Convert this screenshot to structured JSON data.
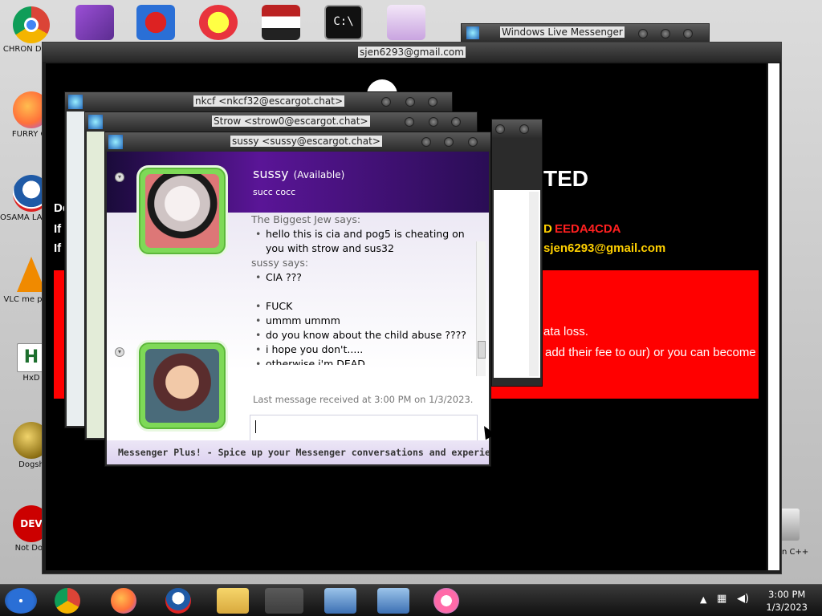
{
  "desktop": {
    "icons": [
      {
        "label": "CHRON DISEA",
        "icon": "chrome-icon",
        "color": "#db4437"
      },
      {
        "label": "FURRY CL",
        "icon": "firefox-icon",
        "color": "#ff7139"
      },
      {
        "label": "OSAMA LADEN B",
        "icon": "obama-logo-icon",
        "color": "#1f5aa6"
      },
      {
        "label": "VLC me playe",
        "icon": "vlc-cone-icon",
        "color": "#f08a00"
      },
      {
        "label": "HxD",
        "icon": "hxd-icon",
        "color": "#1d6f2e"
      },
      {
        "label": "Dogsh",
        "icon": "dogsh-icon",
        "color": "#b8860b"
      },
      {
        "label": "Not Dog",
        "icon": "dev-cpp-icon",
        "color": "#cc0000"
      }
    ],
    "top_icons": [
      "visual-studio-icon",
      "pog-2-icon",
      "pog-p-icon",
      "flag-icon",
      "terminal-icon",
      "anime-figure-icon"
    ],
    "recycle_label": "n C++"
  },
  "windows": {
    "live_messenger_title": "Windows Live Messenger",
    "ransom": {
      "title": "sjen6293@gmail.com",
      "heading_fragment": "TED",
      "left_frags": [
        "De",
        "If",
        "If"
      ],
      "id_frag": "D",
      "id_value": "EEDA4CDA",
      "email_frag": "sjen6293@gmail.com",
      "red_line1": "ata loss.",
      "red_line2": "add their fee to our) or you can become"
    },
    "nkcf_title": "nkcf <nkcf32@escargot.chat>",
    "strow_title": "Strow <strow0@escargot.chat>",
    "sussy": {
      "title": "sussy <sussy@escargot.chat>",
      "contact_name": "sussy",
      "status": "(Available)",
      "personal_message": "succ cocc",
      "conversation": [
        {
          "who": "The Biggest Jew says:"
        },
        {
          "msg": "hello this is cia and pog5 is cheating on you with strow and sus32"
        },
        {
          "who": "sussy says:"
        },
        {
          "msg": "CIA ???"
        },
        {
          "blank": true
        },
        {
          "msg": "FUCK"
        },
        {
          "msg": "ummm ummm"
        },
        {
          "msg": "do you know about the child abuse ????"
        },
        {
          "msg": "i hope you don't....."
        },
        {
          "msg": "otherwise i'm DEAD"
        }
      ],
      "last_message": "Last message received at 3:00 PM on 1/3/2023.",
      "ad_text": "Messenger Plus! - Spice up your Messenger conversations and experience w..."
    }
  },
  "taskbar": {
    "apps": [
      "start-orb-icon",
      "chrome-icon",
      "firefox-icon",
      "obama-logo-icon",
      "file-explorer-icon",
      "messenger-icon",
      "remote-desktop-icon",
      "remote-desktop-icon",
      "paint-icon"
    ],
    "clock_time": "3:00 PM",
    "clock_date": "1/3/2023"
  }
}
